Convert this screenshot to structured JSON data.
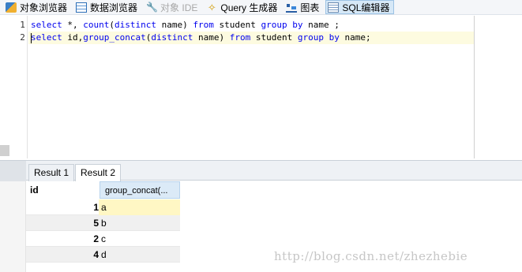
{
  "toolbar": {
    "items": [
      {
        "label": "对象浏览器"
      },
      {
        "label": "数据浏览器"
      },
      {
        "label": "对象 IDE"
      },
      {
        "label": "Query 生成器"
      },
      {
        "label": "图表"
      },
      {
        "label": "SQL编辑器"
      }
    ]
  },
  "editor": {
    "lines": [
      {
        "number": "1",
        "text": "select *, count(distinct name) from student group by name ;"
      },
      {
        "number": "2",
        "text": "select id,group_concat(distinct name) from student group by name;"
      }
    ]
  },
  "result_tabs": [
    {
      "label": "Result 1"
    },
    {
      "label": "Result 2"
    }
  ],
  "grid": {
    "columns": [
      "id",
      "group_concat(..."
    ],
    "rows": [
      {
        "id": "1",
        "value": "a"
      },
      {
        "id": "5",
        "value": "b"
      },
      {
        "id": "2",
        "value": "c"
      },
      {
        "id": "4",
        "value": "d"
      }
    ]
  },
  "watermark": "http://blog.csdn.net/zhezhebie",
  "colors": {
    "keyword": "#0000ee",
    "active_tab": "#d6e8f7",
    "selected_cell": "#fff7c4"
  }
}
